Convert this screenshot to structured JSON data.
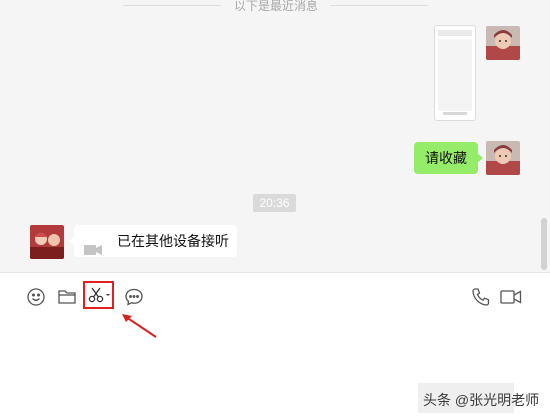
{
  "chat": {
    "divider_text": "以下是最近消息",
    "image_message": {
      "kind": "phone-screenshot-thumbnail"
    },
    "text_message_right": "请收藏",
    "time_stamp": "20:36",
    "call_message": {
      "icon": "video-camera-icon",
      "text": "已在其他设备接听"
    }
  },
  "toolbar": {
    "left_tools": [
      "emoji-icon",
      "folder-icon",
      "scissors-icon",
      "chat-bubble-icon"
    ],
    "right_tools": [
      "phone-icon",
      "video-call-icon"
    ]
  },
  "watermark": {
    "text": "头条 @张光明老师"
  },
  "colors": {
    "sent_bubble": "#95ec69",
    "highlight": "#e02020",
    "background": "#f5f5f5"
  }
}
